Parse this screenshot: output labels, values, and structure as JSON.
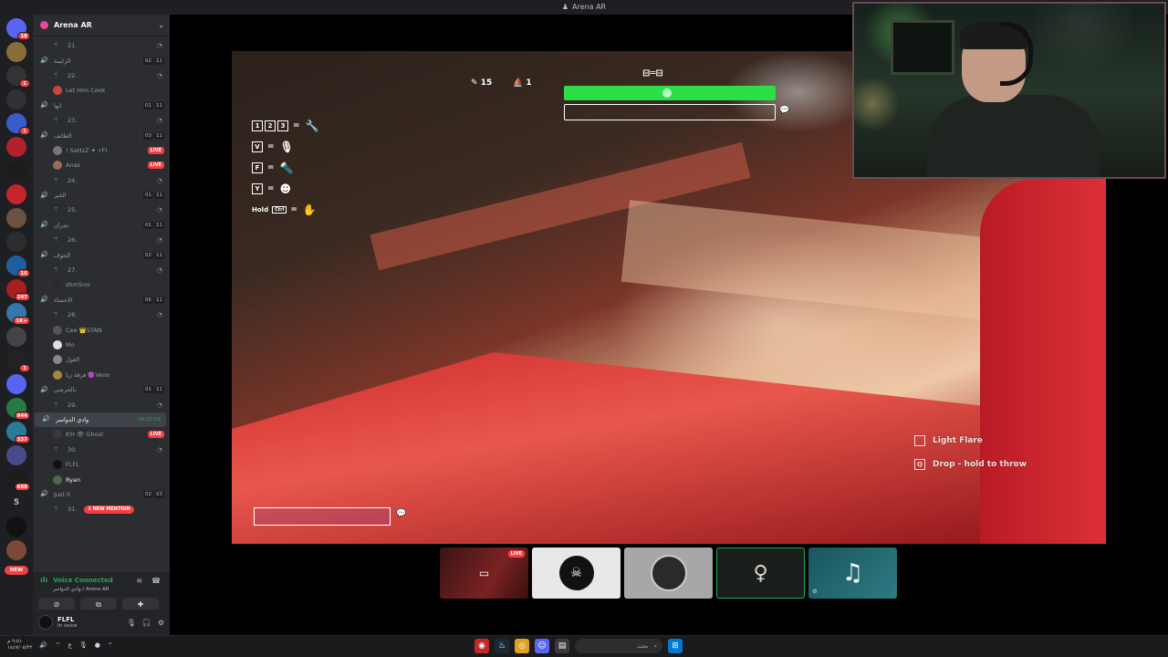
{
  "window": {
    "title": "Arena AR"
  },
  "rail": {
    "servers": [
      {
        "color": "#5865f2",
        "badge": "18",
        "icon": "discord-icon"
      },
      {
        "color": "#8a6d3b",
        "badge": ""
      },
      {
        "color": "#333333",
        "badge": "1"
      },
      {
        "color": "#2f3136",
        "badge": ""
      },
      {
        "color": "#3b5ccc",
        "badge": "1"
      },
      {
        "color": "#b21f2d",
        "badge": ""
      },
      {
        "color": "#1c1c1c",
        "badge": ""
      },
      {
        "color": "#c3252b",
        "badge": ""
      },
      {
        "color": "#6b5142",
        "badge": ""
      },
      {
        "color": "#2d2d2d",
        "badge": ""
      },
      {
        "color": "#1f5fa0",
        "badge": "16"
      },
      {
        "color": "#a61e1e",
        "badge": "247"
      },
      {
        "color": "#3577a8",
        "badge": "1K+"
      },
      {
        "color": "#444444",
        "badge": ""
      },
      {
        "color": "#222222",
        "badge": "1"
      },
      {
        "color": "#5865f2",
        "badge": ""
      },
      {
        "color": "#267a43",
        "badge": "944"
      },
      {
        "color": "#2a7a9a",
        "badge": "337"
      },
      {
        "color": "#4a4a8a",
        "badge": ""
      },
      {
        "color": "#1c1c1c",
        "badge": "688"
      },
      {
        "color": "#111111",
        "badge": ""
      },
      {
        "color": "#7a4a36",
        "badge": ""
      }
    ],
    "folder_count": "5",
    "new_label": "NEW"
  },
  "guild": {
    "name": "Arena AR"
  },
  "channels": [
    {
      "kind": "sub",
      "name": "21."
    },
    {
      "kind": "voice",
      "name": "الرايمة",
      "counts": [
        "02",
        "11"
      ]
    },
    {
      "kind": "sub",
      "name": "22."
    },
    {
      "kind": "user",
      "name": "Let Him Cook",
      "avatar": "#c9463d"
    },
    {
      "kind": "voice",
      "name": "ابها",
      "counts": [
        "01",
        "11"
      ]
    },
    {
      "kind": "sub",
      "name": "23."
    },
    {
      "kind": "voice",
      "name": "الطائف",
      "counts": [
        "03",
        "11"
      ]
    },
    {
      "kind": "user",
      "name": "! SaHzZ ✦ ⚡FI",
      "avatar": "#777777",
      "live": "LIVE"
    },
    {
      "kind": "user",
      "name": "Anas",
      "avatar": "#9b6a55",
      "live": "LIVE"
    },
    {
      "kind": "sub",
      "name": "24."
    },
    {
      "kind": "voice",
      "name": "الخبر",
      "counts": [
        "01",
        "11"
      ]
    },
    {
      "kind": "sub",
      "name": "25."
    },
    {
      "kind": "voice",
      "name": "نجران",
      "counts": [
        "01",
        "11"
      ]
    },
    {
      "kind": "sub",
      "name": "26."
    },
    {
      "kind": "voice",
      "name": "الجوف",
      "counts": [
        "02",
        "11"
      ]
    },
    {
      "kind": "sub",
      "name": "27."
    },
    {
      "kind": "user",
      "name": "shm5ror",
      "avatar": "#2b2b2b"
    },
    {
      "kind": "voice",
      "name": "الاحساء",
      "counts": [
        "05",
        "11"
      ]
    },
    {
      "kind": "sub",
      "name": "28."
    },
    {
      "kind": "user",
      "name": "Cee 👑STAN",
      "avatar": "#555555"
    },
    {
      "kind": "user",
      "name": "Mo",
      "avatar": "#e0e0e0"
    },
    {
      "kind": "user",
      "name": "الغول",
      "avatar": "#888888"
    },
    {
      "kind": "user",
      "name": "فرقة زيا 🟣Veoo",
      "avatar": "#a8893a"
    },
    {
      "kind": "voice",
      "name": "بالجرشي",
      "counts": [
        "01",
        "11"
      ]
    },
    {
      "kind": "sub",
      "name": "29."
    },
    {
      "kind": "voice",
      "name": "وادي الدواسر",
      "timer": "00:35:59",
      "active": true
    },
    {
      "kind": "user",
      "name": "ΚΉ 👁 Ghost",
      "avatar": "#3a3a3a",
      "live": "LIVE"
    },
    {
      "kind": "sub",
      "name": "30."
    },
    {
      "kind": "user",
      "name": "FLFL",
      "avatar": "#111111"
    },
    {
      "kind": "user",
      "name": "Ryan",
      "avatar": "#4a6a4a",
      "bold": true
    },
    {
      "kind": "voice",
      "name": "Just II",
      "counts": [
        "02",
        "03"
      ]
    },
    {
      "kind": "sub",
      "name": "31.",
      "mention": "1 NEW MENTION"
    }
  ],
  "voice_panel": {
    "status": "Voice Connected",
    "location": "وادي الدواسر / Arena AR"
  },
  "user_panel": {
    "name": "FLFL",
    "status": "In voice"
  },
  "hud": {
    "pencil_count": "15",
    "boat_count": "1",
    "health_fraction": 1.0,
    "keybinds": [
      {
        "keys": [
          "1",
          "2",
          "3"
        ],
        "icon": "wrench-icon",
        "glyph": "🔧"
      },
      {
        "keys": [
          "V"
        ],
        "icon": "microphone-icon",
        "glyph": "🎙"
      },
      {
        "keys": [
          "F"
        ],
        "icon": "flashlight-icon",
        "glyph": "🔦"
      },
      {
        "keys": [
          "Y"
        ],
        "icon": "emote-icon",
        "glyph": "☻"
      }
    ],
    "hold_label": "Hold",
    "ctrl_label": "Ctrl",
    "equals": "=",
    "actions": [
      {
        "key": "",
        "label": "Light Flare"
      },
      {
        "key": "Q",
        "label": "Drop - hold to throw"
      }
    ]
  },
  "streams": [
    {
      "name": "tile-game-stream",
      "live": "LIVE"
    },
    {
      "name": "tile-skull"
    },
    {
      "name": "tile-avatar"
    },
    {
      "name": "tile-figure"
    },
    {
      "name": "tile-music"
    }
  ],
  "taskbar": {
    "time": "٩:٥١ م",
    "date": "١٤٤٧/٠٥/٢٢",
    "lang": "ع",
    "search_placeholder": "بحث"
  }
}
